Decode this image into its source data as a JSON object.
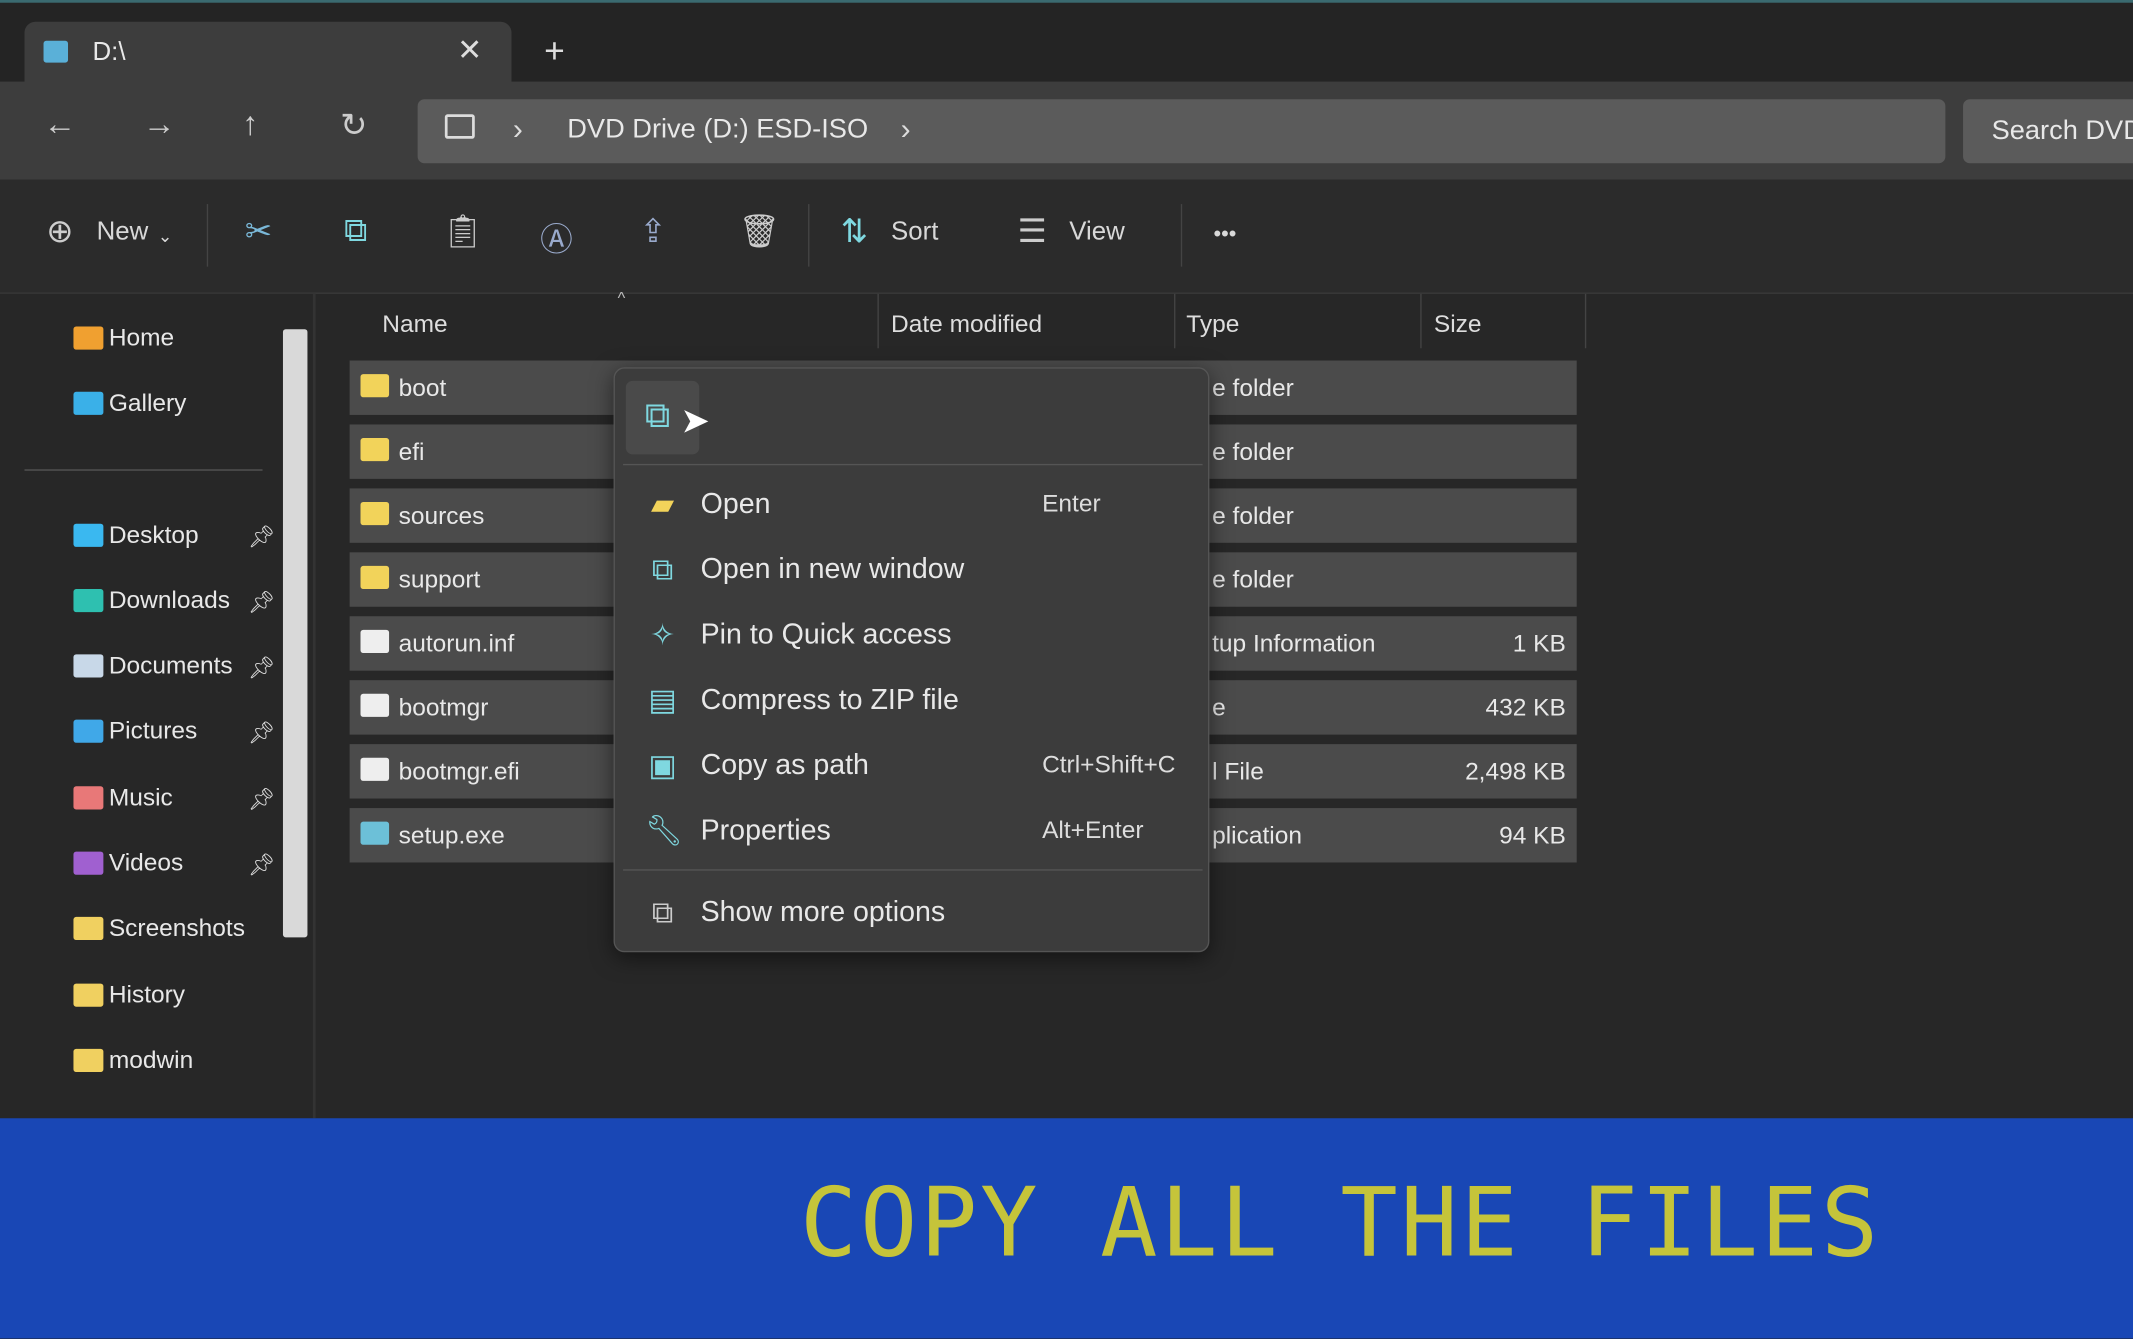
{
  "tab": {
    "title": "D:\\",
    "close": "✕",
    "new_tab": "+"
  },
  "nav": {
    "back": "←",
    "forward": "→",
    "up": "↑",
    "refresh": "↻"
  },
  "address": {
    "crumb": "DVD Drive (D:) ESD-ISO",
    "sep": "›"
  },
  "search": {
    "placeholder": "Search DVD"
  },
  "toolbar": {
    "new": "New",
    "sort": "Sort",
    "view": "View",
    "more": "•••"
  },
  "sidebar": {
    "items": [
      {
        "label": "Home",
        "color": "#f0a030"
      },
      {
        "label": "Gallery",
        "color": "#3ab0e8"
      },
      {
        "label": "Desktop",
        "color": "#3ab8f0",
        "pinned": true
      },
      {
        "label": "Downloads",
        "color": "#2ec0b0",
        "pinned": true
      },
      {
        "label": "Documents",
        "color": "#c8d8e8",
        "pinned": true
      },
      {
        "label": "Pictures",
        "color": "#40a8e8",
        "pinned": true
      },
      {
        "label": "Music",
        "color": "#e87878",
        "pinned": true
      },
      {
        "label": "Videos",
        "color": "#a060d0",
        "pinned": true
      },
      {
        "label": "Screenshots",
        "color": "#f0d060"
      },
      {
        "label": "History",
        "color": "#f0d060"
      },
      {
        "label": "modwin",
        "color": "#f0d060"
      }
    ]
  },
  "columns": [
    "Name",
    "Date modified",
    "Type",
    "Size"
  ],
  "files": [
    {
      "name": "boot",
      "type": "e folder",
      "size": "",
      "kind": "folder"
    },
    {
      "name": "efi",
      "type": "e folder",
      "size": "",
      "kind": "folder"
    },
    {
      "name": "sources",
      "type": "e folder",
      "size": "",
      "kind": "folder"
    },
    {
      "name": "support",
      "type": "e folder",
      "size": "",
      "kind": "folder"
    },
    {
      "name": "autorun.inf",
      "type": "tup Information",
      "size": "1 KB",
      "kind": "file"
    },
    {
      "name": "bootmgr",
      "type": "e",
      "size": "432 KB",
      "kind": "file"
    },
    {
      "name": "bootmgr.efi",
      "type": "l File",
      "size": "2,498 KB",
      "kind": "file"
    },
    {
      "name": "setup.exe",
      "type": "plication",
      "size": "94 KB",
      "kind": "exe"
    }
  ],
  "context_menu": {
    "items": [
      {
        "label": "Open",
        "shortcut": "Enter",
        "icon": "folder-icon"
      },
      {
        "label": "Open in new window",
        "shortcut": "",
        "icon": "open-external-icon"
      },
      {
        "label": "Pin to Quick access",
        "shortcut": "",
        "icon": "pin-icon"
      },
      {
        "label": "Compress to ZIP file",
        "shortcut": "",
        "icon": "zip-icon"
      },
      {
        "label": "Copy as path",
        "shortcut": "Ctrl+Shift+C",
        "icon": "copy-path-icon"
      },
      {
        "label": "Properties",
        "shortcut": "Alt+Enter",
        "icon": "wrench-icon"
      }
    ],
    "more": "Show more options"
  },
  "banner": {
    "caption": "COPY ALL THE FILES",
    "color": "#c5c43a",
    "bg": "#1947b5"
  }
}
